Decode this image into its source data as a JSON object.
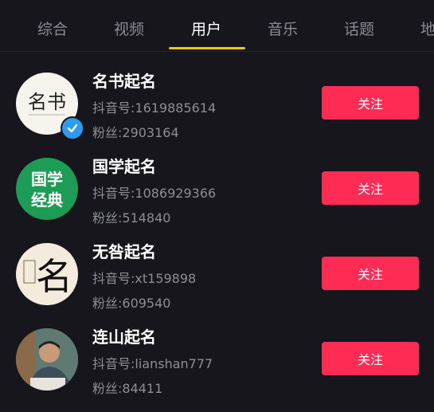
{
  "tabs": [
    {
      "label": "综合"
    },
    {
      "label": "视频"
    },
    {
      "label": "用户"
    },
    {
      "label": "音乐"
    },
    {
      "label": "话题"
    },
    {
      "label": "地"
    }
  ],
  "active_tab": "用户",
  "users": [
    {
      "name": "名书起名",
      "id_text": "抖音号:1619885614",
      "fans_text": "粉丝:2903164",
      "follow_label": "关注",
      "verified": true,
      "avatar_text": "名书"
    },
    {
      "name": "国学起名",
      "id_text": "抖音号:1086929366",
      "fans_text": "粉丝:514840",
      "follow_label": "关注",
      "verified": false,
      "avatar_line1": "国学",
      "avatar_line2": "经典"
    },
    {
      "name": "无咎起名",
      "id_text": "抖音号:xt159898",
      "fans_text": "粉丝:609540",
      "follow_label": "关注",
      "verified": false,
      "avatar_text": "名"
    },
    {
      "name": "连山起名",
      "id_text": "抖音号:lianshan777",
      "fans_text": "粉丝:84411",
      "follow_label": "关注",
      "verified": false
    }
  ],
  "colors": {
    "background": "#16161c",
    "accent_tab": "#f2c40f",
    "follow_button": "#fe2c55",
    "verify_badge": "#2d9bf0"
  }
}
